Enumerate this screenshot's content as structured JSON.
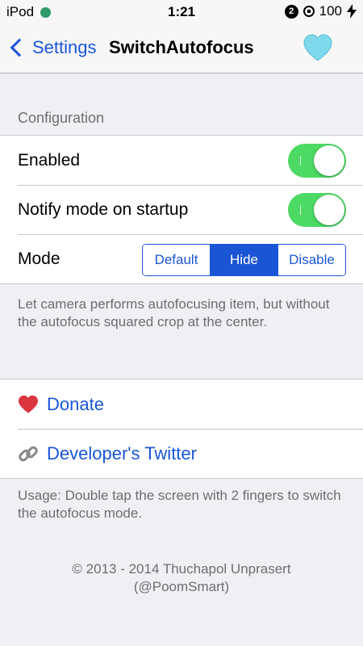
{
  "status_bar": {
    "carrier": "iPod",
    "time": "1:21",
    "notification_count": "2",
    "battery": "100"
  },
  "nav": {
    "back_label": "Settings",
    "title": "SwitchAutofocus",
    "heart_color": "#7fd9ec"
  },
  "configuration": {
    "header": "Configuration",
    "enabled_label": "Enabled",
    "enabled_on": true,
    "notify_label": "Notify mode on startup",
    "notify_on": true,
    "mode_label": "Mode",
    "modes": [
      "Default",
      "Hide",
      "Disable"
    ],
    "selected_mode": "Hide",
    "footer": "Let camera performs autofocusing item, but without the autofocus squared crop at the center."
  },
  "links": {
    "donate_label": "Donate",
    "twitter_label": "Developer's Twitter",
    "footer": "Usage: Double tap the screen with 2 fingers to switch the autofocus mode."
  },
  "copyright": {
    "line1": "© 2013 - 2014 Thuchapol Unprasert",
    "line2": "(@PoomSmart)"
  },
  "colors": {
    "accent": "#1a55d6",
    "switch_on": "#4cd964"
  }
}
